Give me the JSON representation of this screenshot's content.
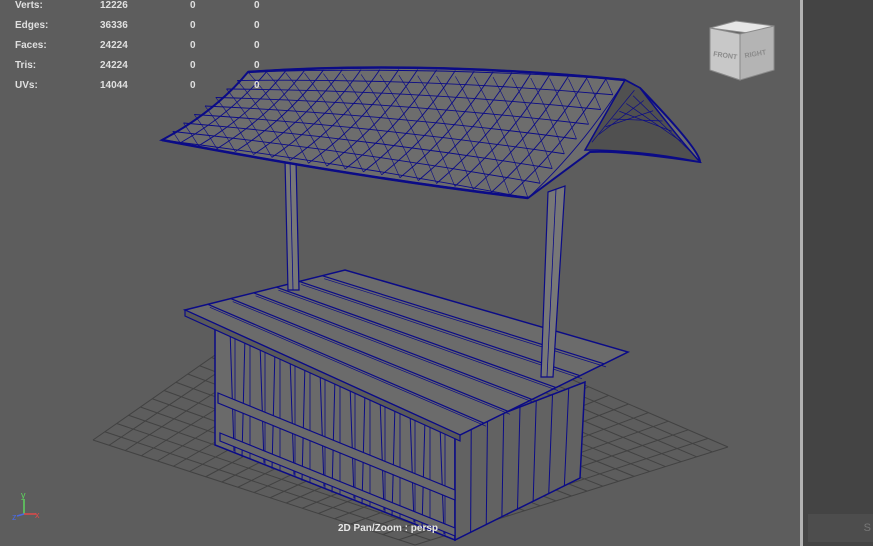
{
  "hud": {
    "rows": [
      {
        "label": "Verts:",
        "v1": "12226",
        "v2": "0",
        "v3": "0"
      },
      {
        "label": "Edges:",
        "v1": "36336",
        "v2": "0",
        "v3": "0"
      },
      {
        "label": "Faces:",
        "v1": "24224",
        "v2": "0",
        "v3": "0"
      },
      {
        "label": "Tris:",
        "v1": "24224",
        "v2": "0",
        "v3": "0"
      },
      {
        "label": "UVs:",
        "v1": "14044",
        "v2": "0",
        "v3": "0"
      }
    ]
  },
  "viewcube": {
    "front": "FRONT",
    "right": "RIGHT"
  },
  "camera_label": "2D Pan/Zoom : persp",
  "axis": {
    "x": "x",
    "y": "y",
    "z": "z"
  },
  "side_panel": {
    "partial_label": "S"
  },
  "colors": {
    "viewport_bg": "#5d5d5d",
    "wire": "#0b0b86",
    "grid": "#3e3e3e",
    "hud_text": "#e0e0e0"
  }
}
